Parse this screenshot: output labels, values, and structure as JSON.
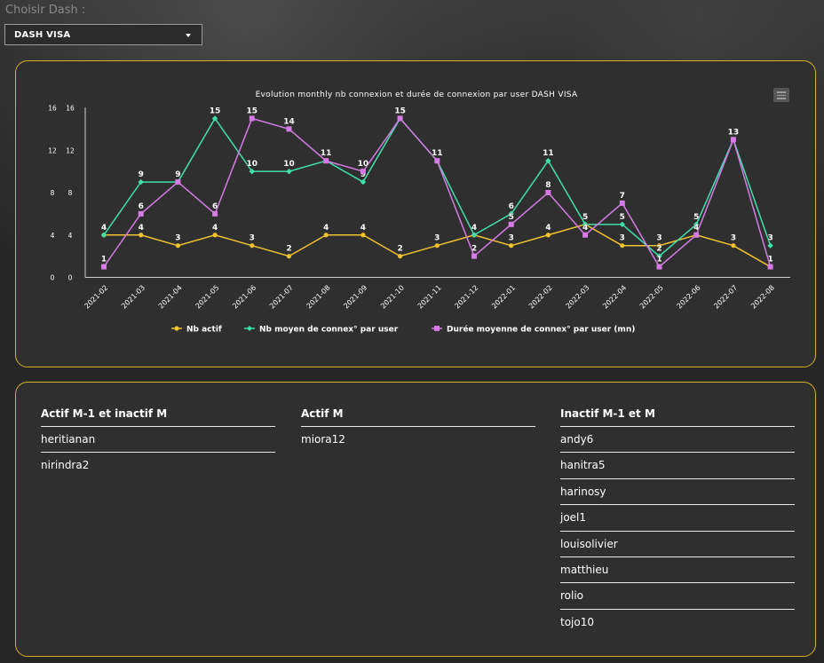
{
  "selector": {
    "label": "Choisir Dash :",
    "value": "DASH VISA"
  },
  "chart_data": {
    "type": "line",
    "title": "Evolution monthly nb connexion et durée de connexion par user DASH VISA",
    "categories": [
      "2021-02",
      "2021-03",
      "2021-04",
      "2021-05",
      "2021-06",
      "2021-07",
      "2021-08",
      "2021-09",
      "2021-10",
      "2021-11",
      "2021-12",
      "2022-01",
      "2022-02",
      "2022-03",
      "2022-04",
      "2022-05",
      "2022-06",
      "2022-07",
      "2022-08"
    ],
    "y_ticks": [
      0,
      4,
      8,
      12,
      16
    ],
    "ylim": [
      0,
      16
    ],
    "series": [
      {
        "name": "Nb actif",
        "color": "#f2c12e",
        "marker": "circle",
        "values": [
          4,
          4,
          3,
          4,
          3,
          2,
          4,
          4,
          2,
          3,
          4,
          3,
          4,
          5,
          3,
          3,
          4,
          3,
          1
        ]
      },
      {
        "name": "Nb moyen de connex° par user",
        "color": "#3fe0ac",
        "marker": "diamond",
        "values": [
          4,
          9,
          9,
          15,
          10,
          10,
          11,
          9,
          15,
          11,
          4,
          6,
          11,
          5,
          5,
          2,
          5,
          13,
          3
        ]
      },
      {
        "name": "Durée moyenne de connex° par user (mn)",
        "color": "#d67be6",
        "marker": "square",
        "values": [
          1,
          6,
          9,
          6,
          15,
          14,
          11,
          10,
          15,
          11,
          2,
          5,
          8,
          4,
          7,
          1,
          4,
          13,
          1
        ]
      }
    ],
    "legend_position": "bottom"
  },
  "lists": {
    "actif_prev_inactif": {
      "title": "Actif M-1 et inactif M",
      "items": [
        "heritianan",
        "nirindra2"
      ]
    },
    "actif": {
      "title": "Actif M",
      "items": [
        "miora12"
      ]
    },
    "inactif": {
      "title": "Inactif M-1 et M",
      "items": [
        "andy6",
        "hanitra5",
        "harinosy",
        "joel1",
        "louisolivier",
        "matthieu",
        "rolio",
        "tojo10"
      ]
    }
  }
}
